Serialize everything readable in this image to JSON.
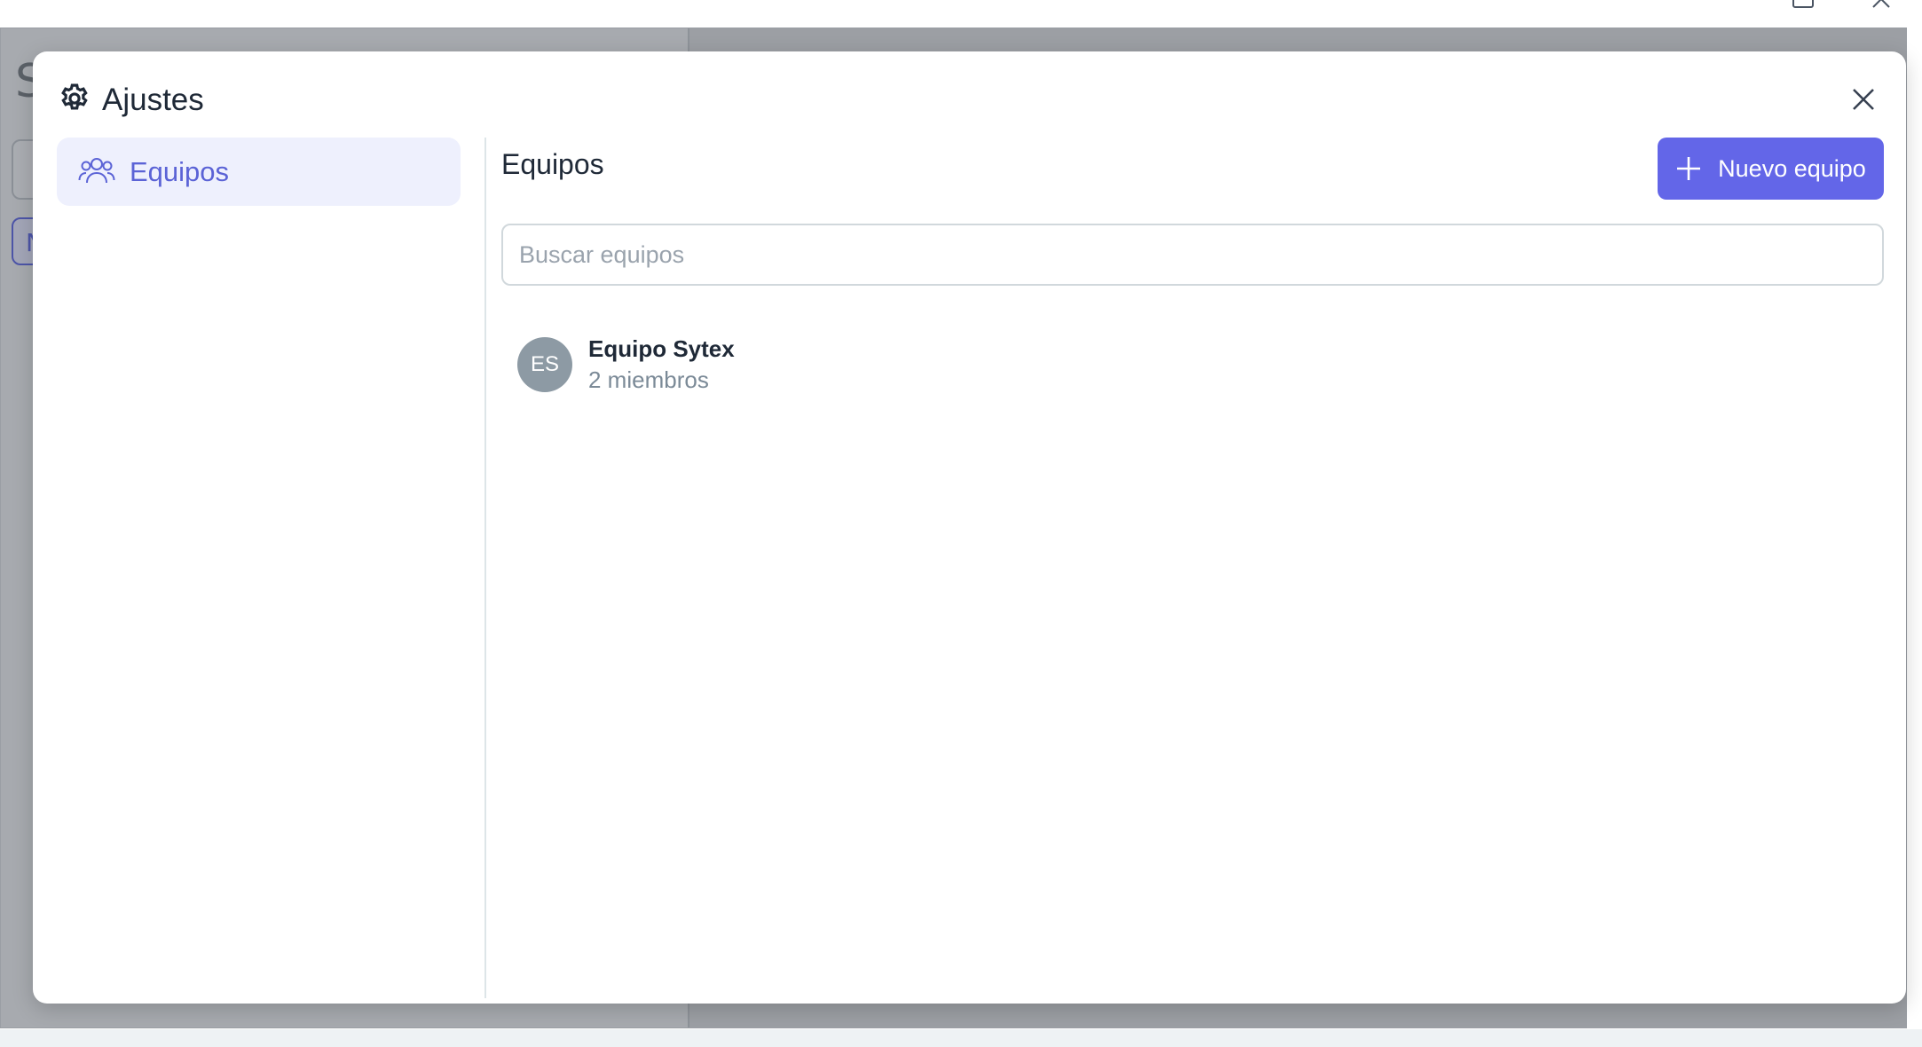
{
  "background_app": {
    "title_fragment": "S",
    "pill_fragment": "N"
  },
  "modal": {
    "title": "Ajustes",
    "nav": {
      "items": [
        {
          "label": "Equipos",
          "icon": "users-icon",
          "active": true
        }
      ]
    },
    "content": {
      "title": "Equipos",
      "new_team_label": "Nuevo equipo",
      "search": {
        "placeholder": "Buscar equipos",
        "value": ""
      },
      "teams": [
        {
          "initials": "ES",
          "name": "Equipo Sytex",
          "members": "2 miembros"
        }
      ]
    }
  },
  "colors": {
    "accent": "#6366e8",
    "nav_active_bg": "#eef0fd",
    "avatar_bg": "#8d9aa4",
    "overlay": "#a3a6ab"
  }
}
